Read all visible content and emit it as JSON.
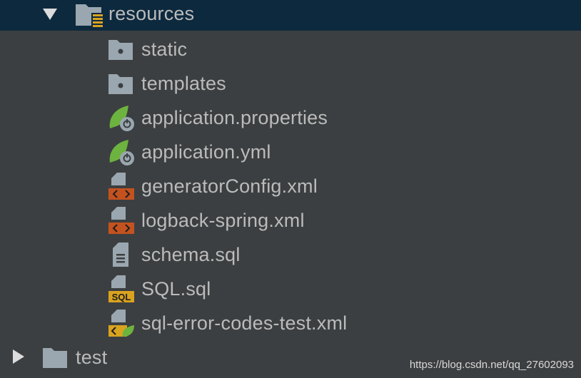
{
  "tree": {
    "resources": {
      "label": "resources",
      "expanded": true,
      "icon": "resources-folder-icon"
    },
    "children": [
      {
        "label": "static",
        "icon": "folder-icon"
      },
      {
        "label": "templates",
        "icon": "folder-icon"
      },
      {
        "label": "application.properties",
        "icon": "spring-config-icon"
      },
      {
        "label": "application.yml",
        "icon": "spring-config-icon"
      },
      {
        "label": "generatorConfig.xml",
        "icon": "xml-file-icon"
      },
      {
        "label": "logback-spring.xml",
        "icon": "xml-file-icon"
      },
      {
        "label": "schema.sql",
        "icon": "text-file-icon"
      },
      {
        "label": "SQL.sql",
        "icon": "sql-file-icon"
      },
      {
        "label": "sql-error-codes-test.xml",
        "icon": "spring-xml-file-icon"
      }
    ],
    "test": {
      "label": "test",
      "expanded": false,
      "icon": "folder-icon"
    }
  },
  "watermark": "https://blog.csdn.net/qq_27602093",
  "colors": {
    "background": "#3c3f41",
    "selection": "#0d293e",
    "text": "#bbbbbb",
    "folder": "#9aa7b0",
    "spring": "#6db33f",
    "xml": "#c4521f",
    "sql": "#d9a31f"
  }
}
